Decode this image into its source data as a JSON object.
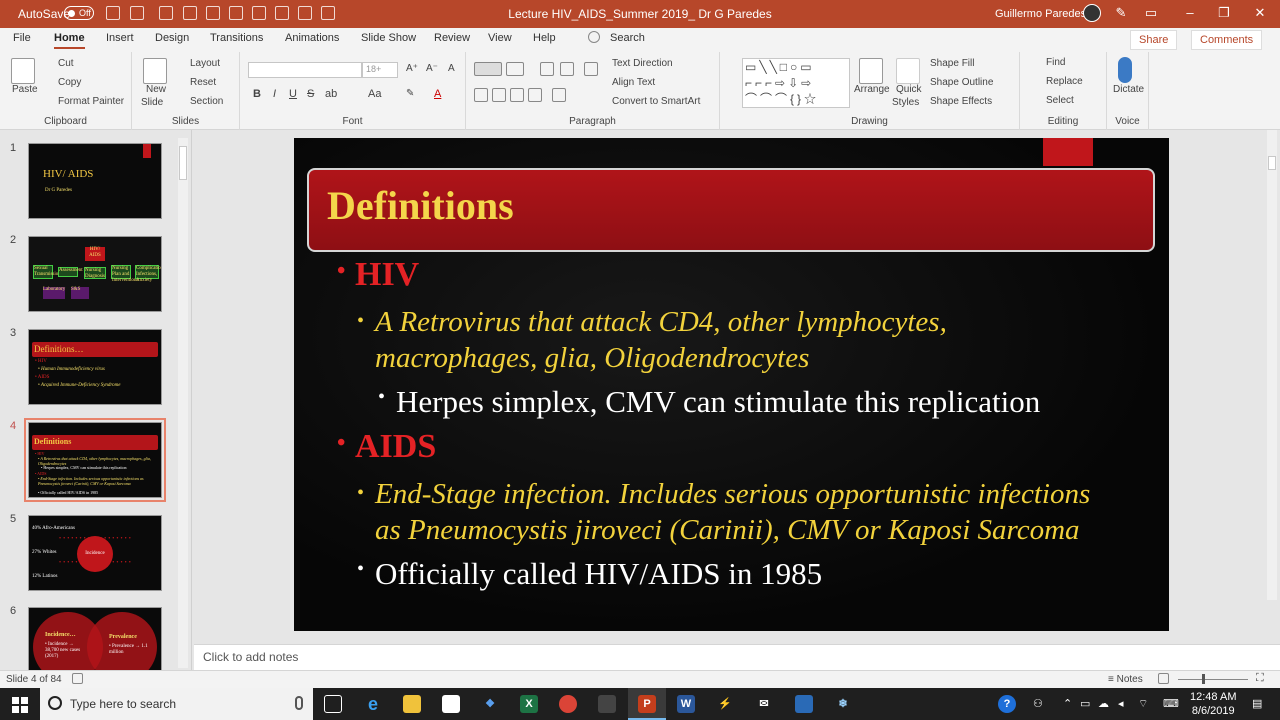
{
  "titlebar": {
    "autosave_label": "AutoSave",
    "autosave_state": "Off",
    "doc_title": "Lecture HIV_AIDS_Summer 2019_ Dr G Paredes",
    "user_name": "Guillermo Paredes"
  },
  "tabs": [
    "File",
    "Home",
    "Insert",
    "Design",
    "Transitions",
    "Animations",
    "Slide Show",
    "Review",
    "View",
    "Help"
  ],
  "active_tab": "Home",
  "tell_me": "Search",
  "share_label": "Share",
  "comments_label": "Comments",
  "ribbon": {
    "clipboard": {
      "paste": "Paste",
      "cut": "Cut",
      "copy": "Copy",
      "format_painter": "Format Painter",
      "label": "Clipboard"
    },
    "slides": {
      "new_slide_1": "New",
      "new_slide_2": "Slide",
      "layout": "Layout",
      "reset": "Reset",
      "section": "Section",
      "label": "Slides"
    },
    "font": {
      "size": "18+",
      "label": "Font",
      "bold": "B",
      "italic": "I",
      "underline": "U",
      "strike": "S",
      "spacing": "ab",
      "case": "Aa"
    },
    "paragraph": {
      "text_direction": "Text Direction",
      "align_text": "Align Text",
      "convert_smartart": "Convert to SmartArt",
      "label": "Paragraph"
    },
    "drawing": {
      "arrange": "Arrange",
      "quick_styles_1": "Quick",
      "quick_styles_2": "Styles",
      "shape_fill": "Shape Fill",
      "shape_outline": "Shape Outline",
      "shape_effects": "Shape Effects",
      "label": "Drawing"
    },
    "editing": {
      "find": "Find",
      "replace": "Replace",
      "select": "Select",
      "label": "Editing"
    },
    "voice": {
      "dictate": "Dictate",
      "label": "Voice"
    }
  },
  "thumbnails": [
    {
      "num": "1",
      "title": "HIV/ AIDS",
      "sub": "Dr G Paredes"
    },
    {
      "num": "2",
      "center": "HIV/ AIDS",
      "nodes": [
        "Sexual Transmission",
        "Assessment",
        "Nursing Diagnosis",
        "Nursing Plan and Interventions",
        "Complications Infections, Anxiety"
      ],
      "nodes2": [
        "Laboratory",
        "S&S"
      ]
    },
    {
      "num": "3",
      "title": "Definitions…",
      "lines": [
        "• HIV",
        "• Human Immunodeficiency virus",
        "• AIDS",
        "• Acquired Immune-Deficiency Syndrome"
      ]
    },
    {
      "num": "4",
      "title": "Definitions",
      "lines": [
        "• HIV",
        "• A Retrovirus that attack CD4, other lymphocytes, macrophages, glia, Oligodendrocytes",
        "• Herpes simplex, CMV can stimulate this replication",
        "• AIDS",
        "• End-Stage infection. Includes serious opportunistic infections as Pneumocystis jiroveci (Carinii), CMV or Kaposi Sarcoma",
        "• Officially called HIV/AIDS in 1985"
      ]
    },
    {
      "num": "5",
      "rows": [
        "40% Afro-Americans",
        "27% Whites",
        "12% Latinos"
      ],
      "center": "Incidence"
    },
    {
      "num": "6",
      "left_title": "Incidence…",
      "left_text": "• Incidence → 38,700 new cases (2017)",
      "right_title": "Prevalence",
      "right_text": "• Prevalence → 1.1 million"
    }
  ],
  "slide": {
    "title": "Definitions",
    "b1": "HIV",
    "b1_sub_line1": "A Retrovirus that attack CD4, other lymphocytes,",
    "b1_sub_line2": "macrophages, glia, Oligodendrocytes",
    "b1_subsub": "Herpes simplex, CMV can stimulate this replication",
    "b2": "AIDS",
    "b2_sub_line1": "End-Stage infection. Includes serious opportunistic infections",
    "b2_sub_line2": "as Pneumocystis jiroveci (Carinii), CMV  or Kaposi Sarcoma",
    "b3": "Officially called HIV/AIDS in 1985",
    "bullet": "•"
  },
  "notes_placeholder": "Click to add notes",
  "status": {
    "slide_info": "Slide 4 of 84",
    "notes": "Notes"
  },
  "taskbar": {
    "search_placeholder": "Type here to search",
    "time": "12:48 AM",
    "date": "8/6/2019"
  },
  "colors": {
    "accent": "#b7472a",
    "slide_title": "#f4d64b",
    "bullet_red": "#e42225",
    "sub_yellow": "#f2d23c"
  }
}
